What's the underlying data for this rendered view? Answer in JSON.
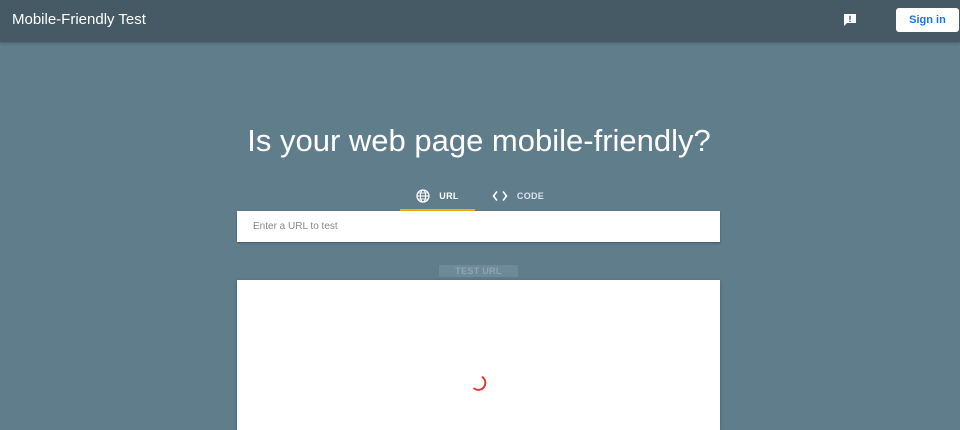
{
  "header": {
    "title": "Mobile-Friendly Test",
    "feedback_icon": "feedback-icon",
    "signin_label": "Sign in"
  },
  "main": {
    "headline": "Is your web page mobile-friendly?",
    "tabs": [
      {
        "label": "URL",
        "icon": "globe-icon",
        "active": true
      },
      {
        "label": "CODE",
        "icon": "code-icon",
        "active": false
      }
    ],
    "url_input": {
      "value": "",
      "placeholder": "Enter a URL to test"
    },
    "test_button_label": "TEST URL",
    "loading_icon": "spinner-icon"
  },
  "colors": {
    "background": "#607d8b",
    "topbar": "#455a64",
    "tab_indicator": "#f9ab00",
    "signin_text": "#1a73e8",
    "spinner": "#e53935"
  }
}
